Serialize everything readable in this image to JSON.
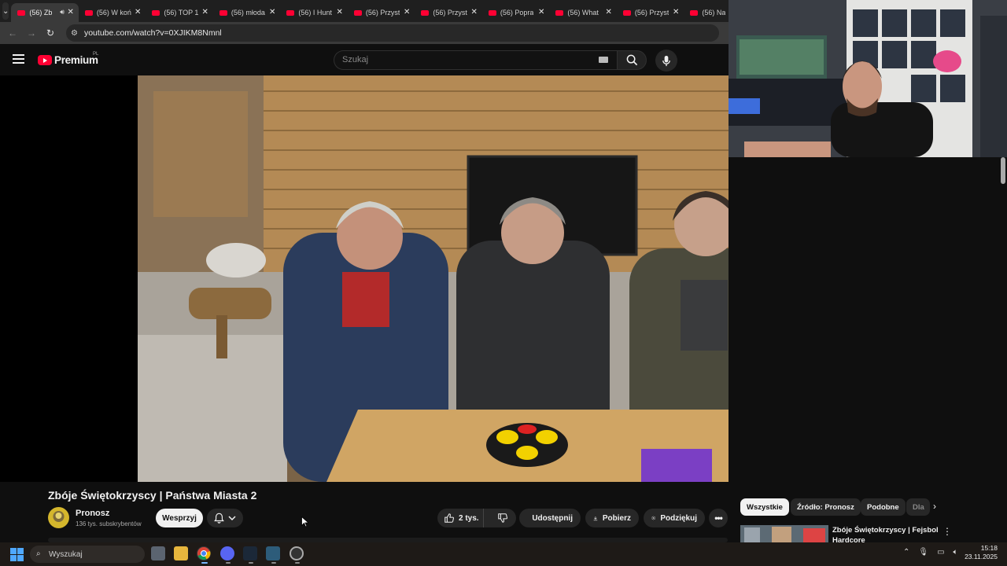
{
  "browser": {
    "tabs": [
      {
        "title": "(56) Zb",
        "active": true,
        "audio": true
      },
      {
        "title": "(56) W koń",
        "active": false
      },
      {
        "title": "(56) TOP 1",
        "active": false
      },
      {
        "title": "(56) młoda",
        "active": false
      },
      {
        "title": "(56) I Hunt",
        "active": false
      },
      {
        "title": "(56) Przyst",
        "active": false
      },
      {
        "title": "(56) Przyst",
        "active": false
      },
      {
        "title": "(56) Popra",
        "active": false
      },
      {
        "title": "(56) What",
        "active": false
      },
      {
        "title": "(56) Przyst",
        "active": false
      },
      {
        "title": "(56) Na",
        "active": false
      }
    ],
    "url": "youtube.com/watch?v=0XJIKM8Nmnl"
  },
  "youtube": {
    "logo_text": "Premium",
    "logo_country": "PL",
    "search_placeholder": "Szukaj"
  },
  "video": {
    "title": "Zbóje Świętokrzyscy | Państwa Miasta 2",
    "channel": "Pronosz",
    "subscribers": "136 tys. subskrybentów",
    "support_label": "Wesprzyj",
    "likes": "2 tys.",
    "share_label": "Udostępnij",
    "download_label": "Pobierz",
    "thanks_label": "Podziękuj"
  },
  "sidebar": {
    "chips": [
      "Wszystkie",
      "Źródło: Pronosz",
      "Podobne",
      "Dla"
    ],
    "recommended": [
      {
        "title": "Zbóje Świętokrzyscy | Fejsbol Hardcore"
      }
    ]
  },
  "taskbar": {
    "search_placeholder": "Wyszukaj",
    "time": "15:18",
    "date": "23.11.2025"
  },
  "colors": {
    "youtube_red": "#ff0033",
    "background": "#0f0f0f",
    "chip_active": "#f1f1f1"
  }
}
